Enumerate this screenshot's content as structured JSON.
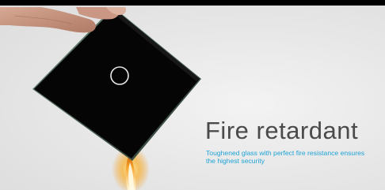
{
  "banner": {
    "headline": "Fire retardant",
    "subline": "Toughened glass with perfect fire resistance ensures the highest  security",
    "colors": {
      "headline": "#4a4a4a",
      "subline": "#1fa3d6",
      "glass_panel": "#050505",
      "touch_ring": "#e8e8e8",
      "flame": "#f39a1d"
    }
  }
}
